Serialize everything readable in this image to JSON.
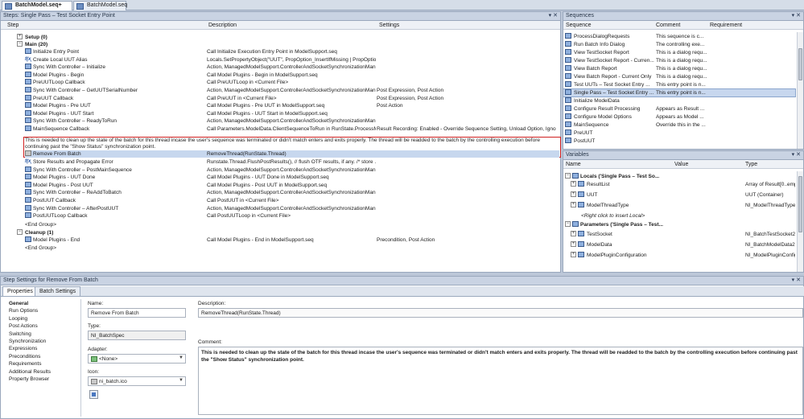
{
  "doc_tabs": [
    {
      "label": "BatchModel.seq+",
      "active": true
    },
    {
      "label": "BatchModel.seq",
      "active": false
    }
  ],
  "steps_pane": {
    "title": "Steps: Single Pass – Test Socket Entry Point",
    "buttons": "▾ ✕",
    "columns": [
      "Step",
      "Description",
      "Settings"
    ],
    "groups": {
      "setup": "Setup (0)",
      "main": "Main (20)",
      "cleanup": "Cleanup (1)",
      "end_group": "<End Group>"
    },
    "main_steps": [
      {
        "icon": "step-icon",
        "step": "Initialize Entry Point",
        "desc": "Call Initialize Execution Entry Point in ModelSupport.seq",
        "settings": ""
      },
      {
        "icon": "fx-icon",
        "step": "Create Local UUT Alias",
        "desc": "Locals.SetPropertyObject(\"UUT\", PropOption_InsertIfMissing | PropOption...",
        "settings": ""
      },
      {
        "icon": "step-icon",
        "step": "Sync With Controller – Initialize",
        "desc": "Action,  ManagedModelSupport.ControllerAndSocketSynchronizationMan...",
        "settings": ""
      },
      {
        "icon": "step-icon",
        "step": "Model Plugins - Begin",
        "desc": "Call Model Plugins - Begin in ModelSupport.seq",
        "settings": ""
      },
      {
        "icon": "step-icon",
        "step": "PreUUTLoop Callback",
        "desc": "Call PreUUTLoop in <Current File>",
        "settings": ""
      },
      {
        "icon": "step-icon",
        "step": "Sync With Controller – GetUUTSerialNumber",
        "desc": "Action,  ManagedModelSupport.ControllerAndSocketSynchronizationMan...",
        "settings": "Post Expression, Post Action"
      },
      {
        "icon": "step-icon",
        "step": "PreUUT Callback",
        "desc": "Call PreUUT in <Current File>",
        "settings": "Post Expression, Post Action"
      },
      {
        "icon": "step-icon",
        "step": "Model Plugins - Pre UUT",
        "desc": "Call Model Plugins - Pre UUT in ModelSupport.seq",
        "settings": "Post Action"
      },
      {
        "icon": "step-icon",
        "step": "Model Plugins - UUT Start",
        "desc": "Call Model Plugins - UUT Start in ModelSupport.seq",
        "settings": ""
      },
      {
        "icon": "step-icon",
        "step": "Sync With Controller – ReadyToRun",
        "desc": "Action,  ManagedModelSupport.ControllerAndSocketSynchronizationMan...",
        "settings": ""
      },
      {
        "icon": "step-icon",
        "step": "MainSequence Callback",
        "desc": "Call Parameters.ModelData.ClientSequenceToRun in RunState.ProcessM...",
        "settings": "Result Recording: Enabled - Override Sequence Setting, Unload Option, Ignore ..."
      }
    ],
    "comment_text": "This is needed to clean up the state of the batch for this thread incase the user's sequence was terminated or didn't match enters and exits properly.  The thread will be readded to the batch by the controlling execution before continuing past the \"Show Status\" synchronization point.",
    "selected_step": {
      "step": "Remove From Batch",
      "desc": "RemoveThread(RunState.Thread)"
    },
    "after_steps": [
      {
        "icon": "fx-icon",
        "step": "Store Results and Propagate Error",
        "desc": "Runstate.Thread.FlushPostResults(),  // flush OTF results, if any.    /* store ...",
        "settings": ""
      },
      {
        "icon": "step-icon",
        "step": "Sync With Controller – PostMainSequence",
        "desc": "Action,  ManagedModelSupport.ControllerAndSocketSynchronizationMan...",
        "settings": ""
      },
      {
        "icon": "step-icon",
        "step": "Model Plugins - UUT Done",
        "desc": "Call Model Plugins - UUT Done in ModelSupport.seq",
        "settings": ""
      },
      {
        "icon": "step-icon",
        "step": "Model Plugins - Post UUT",
        "desc": "Call Model Plugins - Post UUT in ModelSupport.seq",
        "settings": ""
      },
      {
        "icon": "step-icon",
        "step": "Sync With Controller – ReAddToBatch",
        "desc": "Action,  ManagedModelSupport.ControllerAndSocketSynchronizationMan...",
        "settings": ""
      },
      {
        "icon": "step-icon",
        "step": "PostUUT Callback",
        "desc": "Call PostUUT in <Current File>",
        "settings": ""
      },
      {
        "icon": "step-icon",
        "step": "Sync With Controller – AfterPostUUT",
        "desc": "Action,  ManagedModelSupport.ControllerAndSocketSynchronizationMan...",
        "settings": ""
      },
      {
        "icon": "step-icon",
        "step": "PostUUTLoop Callback",
        "desc": "Call PostUUTLoop in <Current File>",
        "settings": ""
      }
    ],
    "cleanup_steps": [
      {
        "icon": "step-icon",
        "step": "Model Plugins - End",
        "desc": "Call Model Plugins - End in ModelSupport.seq",
        "settings": "Precondition, Post Action"
      }
    ]
  },
  "sequences_pane": {
    "title": "Sequences",
    "buttons": "▾ ✕",
    "columns": [
      "Sequence",
      "Comment",
      "Requirement"
    ],
    "rows": [
      {
        "name": "ProcessDialogRequests",
        "comment": "This sequence is c..."
      },
      {
        "name": "Run Batch Info Dialog",
        "comment": "The controlling exe..."
      },
      {
        "name": "View TestSocket Report",
        "comment": "This is a dialog requ..."
      },
      {
        "name": "View TestSocket Report - Curren...",
        "comment": "This is a dialog requ..."
      },
      {
        "name": "View Batch Report",
        "comment": "This is a dialog requ..."
      },
      {
        "name": "View Batch Report - Current Only",
        "comment": "This is a dialog requ..."
      },
      {
        "name": "Test UUTs – Test Socket Entry ...",
        "comment": "This entry point is n..."
      },
      {
        "name": "Single Pass – Test Socket Entry ...",
        "comment": "This entry point is n...",
        "selected": true
      },
      {
        "name": "Initialize ModelData",
        "comment": ""
      },
      {
        "name": "Configure Result Processing",
        "comment": "Appears as Result ..."
      },
      {
        "name": "Configure Model Options",
        "comment": "Appears as Model ..."
      },
      {
        "name": "MainSequence",
        "comment": "Override this in the ..."
      },
      {
        "name": "PreUUT",
        "comment": ""
      },
      {
        "name": "PostUUT",
        "comment": ""
      }
    ]
  },
  "variables_pane": {
    "title": "Variables",
    "buttons": "▾ ✕",
    "columns": [
      "Name",
      "Value",
      "Type"
    ],
    "locals_header": "Locals ('Single Pass – Test So...",
    "locals": [
      {
        "name": "ResultList",
        "value": "",
        "type": "Array of Result[0..empty]"
      },
      {
        "name": "UUT",
        "value": "",
        "type": "UUT (Container)"
      },
      {
        "name": "ModelThreadType",
        "value": "",
        "type": "NI_ModelThreadType (..."
      }
    ],
    "locals_hint": "<Right click to insert Local>",
    "params_header": "Parameters ('Single Pass – Test...",
    "params": [
      {
        "name": "TestSocket",
        "value": "",
        "type": "NI_BatchTestSocket2 ("
      },
      {
        "name": "ModelData",
        "value": "",
        "type": "NI_BatchModelData2 (C"
      },
      {
        "name": "ModelPluginConfiguration",
        "value": "",
        "type": "NI_ModelPluginConfigura"
      }
    ]
  },
  "step_settings": {
    "title": "Step Settings for Remove From Batch",
    "buttons": "▾ ✕",
    "tabs": [
      "Properties",
      "Batch Settings"
    ],
    "nav": [
      "General",
      "Run Options",
      "Looping",
      "Post Actions",
      "Switching",
      "Synchronization",
      "Expressions",
      "Preconditions",
      "Requirements",
      "Additional Results",
      "Property Browser"
    ],
    "name_label": "Name:",
    "name_value": "Remove From Batch",
    "type_label": "Type:",
    "type_value": "NI_BatchSpec",
    "adapter_label": "Adapter:",
    "adapter_value": "<None>",
    "icon_label": "Icon:",
    "icon_value": "ni_batch.ico",
    "description_label": "Description:",
    "description_value": "RemoveThread(RunState.Thread)",
    "comment_label": "Comment:",
    "comment_value": "This is needed to clean up the state of the batch for this thread incase the user's sequence was terminated or didn't match enters and exits properly.  The thread will be readded to the batch by the controlling execution before continuing past the \"Show Status\" synchronization point."
  },
  "colors": {
    "selection": "#c7d7ee",
    "highlight_box": "#d02020",
    "header": "#c9d3e3"
  }
}
